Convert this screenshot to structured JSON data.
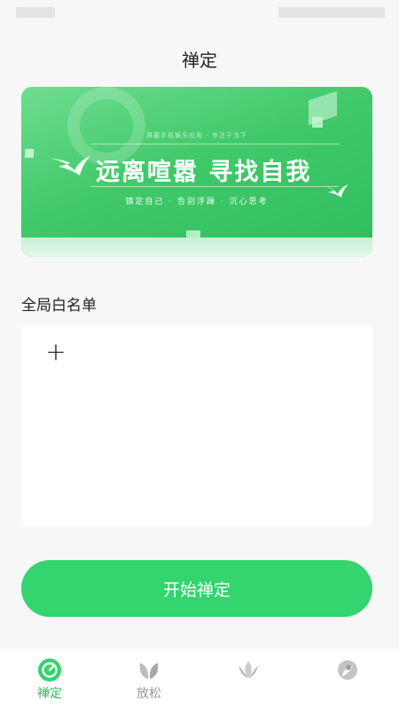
{
  "header": {
    "title": "禅定"
  },
  "banner": {
    "tiny_text": "屏蔽手机娱乐应用 · 专注于当下",
    "slogan": "远离喧嚣  寻找自我",
    "sub_slogan": "镇定自己 · 告别浮躁 · 沉心思考"
  },
  "whitelist": {
    "label": "全局白名单",
    "add_symbol": "+"
  },
  "start_button": {
    "label": "开始禅定"
  },
  "tabbar": {
    "tabs": [
      {
        "label": "禅定",
        "icon": "meditation-timer-icon",
        "active": true
      },
      {
        "label": "放松",
        "icon": "leaf-icon",
        "active": false
      },
      {
        "label": "",
        "icon": "lotus-icon",
        "active": false
      },
      {
        "label": "",
        "icon": "profile-icon",
        "active": false
      }
    ]
  },
  "colors": {
    "accent": "#34d46e",
    "active_tab": "#2fb45d",
    "inactive_tab": "#9a9a9a"
  }
}
